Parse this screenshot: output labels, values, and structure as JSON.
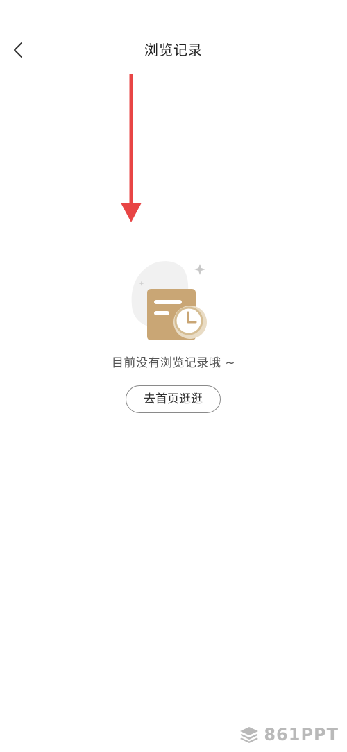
{
  "header": {
    "title": "浏览记录",
    "back_icon": "chevron-left-icon"
  },
  "annotation": {
    "arrow_color": "#e84545"
  },
  "empty_state": {
    "illustration_icon": "browse-history-clock-icon",
    "message": "目前没有浏览记录哦 ~",
    "button_label": "去首页逛逛",
    "accent_color": "#c9a675"
  },
  "watermark": {
    "text": "861PPT",
    "icon": "layers-icon"
  }
}
